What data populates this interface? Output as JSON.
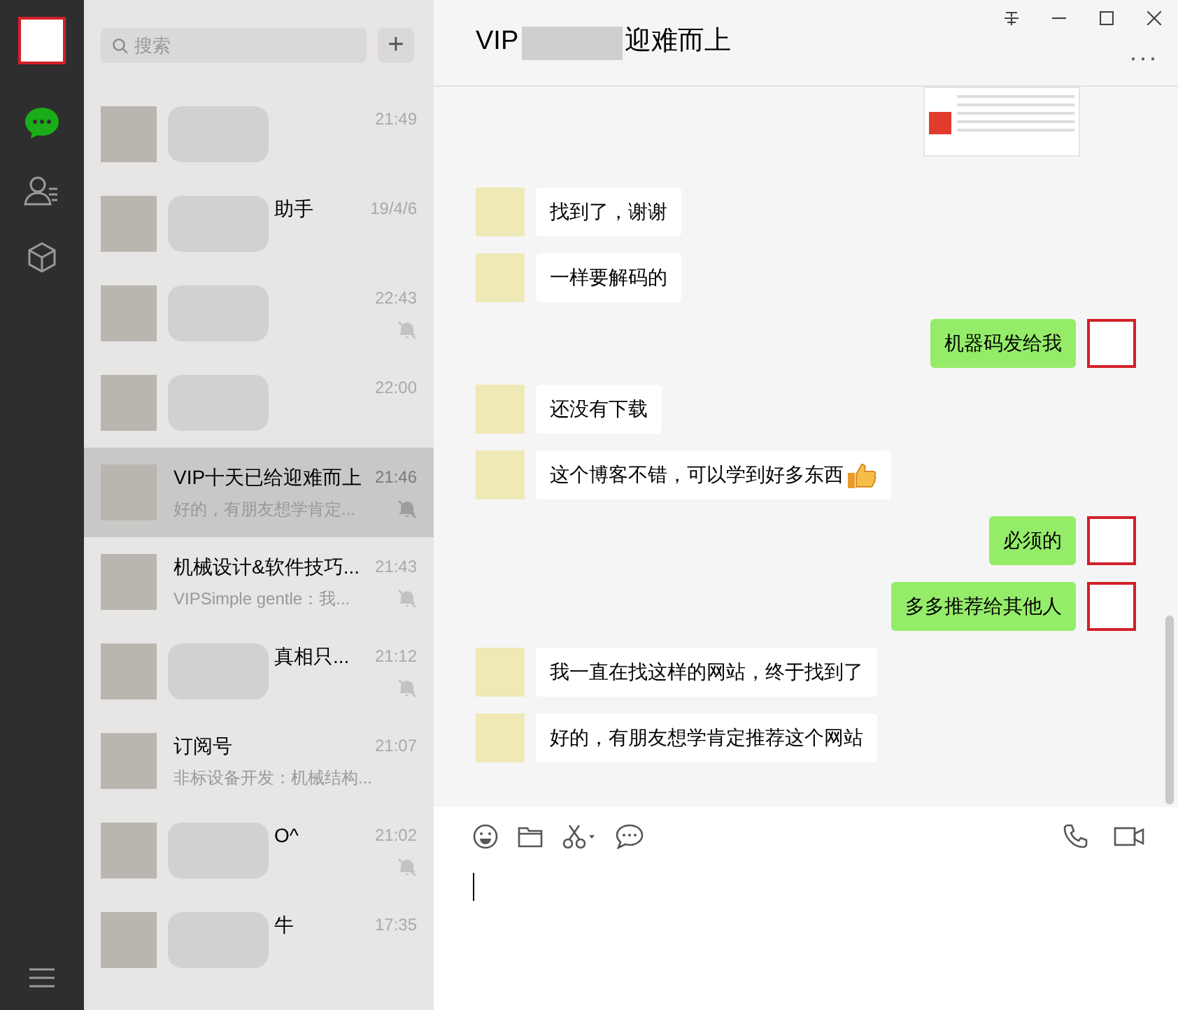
{
  "sidebar": {
    "items": [
      {
        "kind": "chat",
        "selected": true
      },
      {
        "kind": "contacts",
        "selected": false
      },
      {
        "kind": "favorites",
        "selected": false
      }
    ]
  },
  "search": {
    "placeholder": "搜索",
    "add_button": "+"
  },
  "chats": [
    {
      "time": "21:49",
      "muted": false,
      "selected": false,
      "blurred": true
    },
    {
      "name": "助手",
      "time": "19/4/6",
      "muted": false,
      "selected": false,
      "blurred": true
    },
    {
      "time": "22:43",
      "muted": true,
      "selected": false,
      "blurred": true
    },
    {
      "time": "22:00",
      "muted": false,
      "selected": false,
      "blurred": true
    },
    {
      "name": "VIP十天已给迎难而上",
      "preview": "好的，有朋友想学肯定...",
      "time": "21:46",
      "muted": true,
      "selected": true,
      "blurred": false
    },
    {
      "name": "机械设计&软件技巧...",
      "preview": "VIPSimple gentle：我...",
      "time": "21:43",
      "muted": true,
      "selected": false,
      "blurred": false
    },
    {
      "name": "真相只...",
      "time": "21:12",
      "muted": true,
      "selected": false,
      "blurred": true
    },
    {
      "name": "订阅号",
      "preview": "非标设备开发：机械结构...",
      "time": "21:07",
      "muted": false,
      "selected": false,
      "blurred": false
    },
    {
      "name": "O^",
      "time": "21:02",
      "muted": true,
      "selected": false,
      "blurred": true
    },
    {
      "name": "牛",
      "time": "17:35",
      "muted": false,
      "selected": false,
      "blurred": true
    }
  ],
  "header": {
    "title_start": "VIP",
    "title_end": "迎难而上",
    "more": "···"
  },
  "messages": [
    {
      "kind": "image"
    },
    {
      "kind": "text",
      "mine": false,
      "text": "找到了，谢谢"
    },
    {
      "kind": "text",
      "mine": false,
      "text": "一样要解码的"
    },
    {
      "kind": "text",
      "mine": true,
      "text": "机器码发给我"
    },
    {
      "kind": "text",
      "mine": false,
      "text": "还没有下载"
    },
    {
      "kind": "text",
      "mine": false,
      "text": "这个博客不错，可以学到好多东西",
      "thumbs_up": true
    },
    {
      "kind": "text",
      "mine": true,
      "text": "必须的"
    },
    {
      "kind": "text",
      "mine": true,
      "text": "多多推荐给其他人"
    },
    {
      "kind": "text",
      "mine": false,
      "text": "我一直在找这样的网站，终于找到了"
    },
    {
      "kind": "text",
      "mine": false,
      "text": "好的，有朋友想学肯定推荐这个网站"
    }
  ]
}
